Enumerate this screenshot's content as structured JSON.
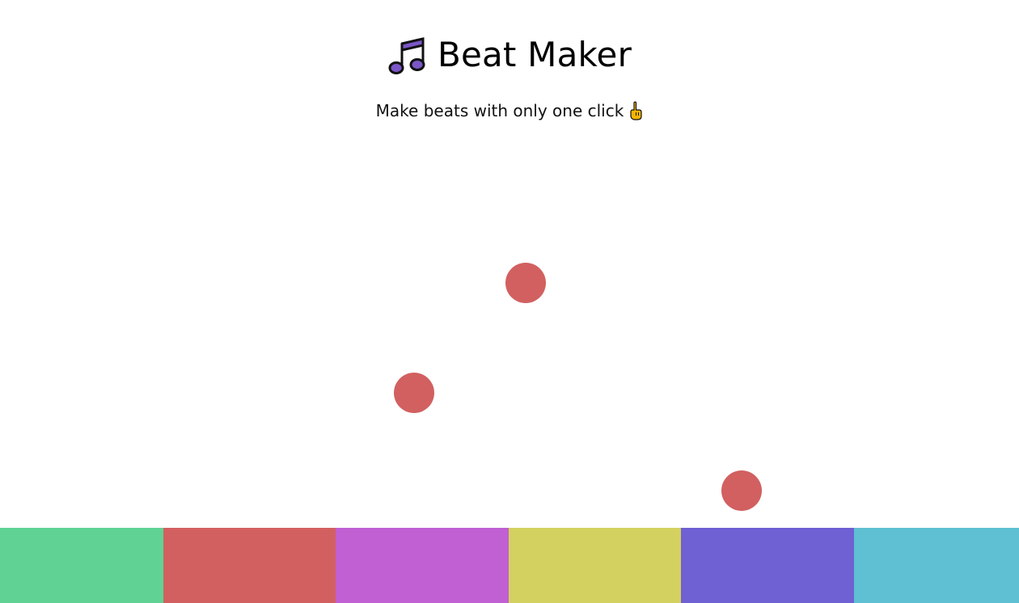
{
  "header": {
    "title": "Beat Maker",
    "subtitle": "Make beats with only one click",
    "title_icon": "musical-notes-icon",
    "subtitle_icon": "pointing-hand-icon"
  },
  "balls": {
    "color": "#d26060",
    "count": 3
  },
  "pads": [
    {
      "name": "pad-1",
      "color": "#60d394"
    },
    {
      "name": "pad-2",
      "color": "#d36060"
    },
    {
      "name": "pad-3",
      "color": "#c060d3"
    },
    {
      "name": "pad-4",
      "color": "#d3d160"
    },
    {
      "name": "pad-5",
      "color": "#6f60d3"
    },
    {
      "name": "pad-6",
      "color": "#60c0d3"
    }
  ]
}
